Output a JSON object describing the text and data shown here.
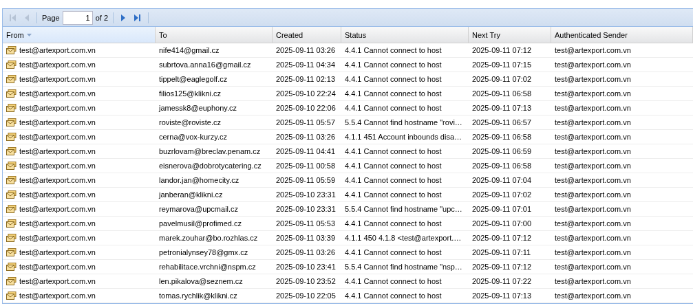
{
  "pager": {
    "buttons": [
      {
        "kind": "first",
        "disabled": true
      },
      {
        "kind": "prev",
        "disabled": true
      },
      {
        "kind": "next",
        "disabled": false
      },
      {
        "kind": "last",
        "disabled": false
      }
    ],
    "page_label": "Page",
    "page_value": "1",
    "page_total": "of 2"
  },
  "table": {
    "columns": [
      {
        "label": "From",
        "sorted": true
      },
      {
        "label": "To",
        "sorted": false
      },
      {
        "label": "Created",
        "sorted": false
      },
      {
        "label": "Status",
        "sorted": false
      },
      {
        "label": "Next Try",
        "sorted": false
      },
      {
        "label": "Authenticated Sender",
        "sorted": false
      }
    ],
    "rows": [
      [
        "test@artexport.com.vn",
        "nife414@gmail.cz",
        "2025-09-11 03:26",
        "4.4.1 Cannot connect to host",
        "2025-09-11 07:12",
        "test@artexport.com.vn"
      ],
      [
        "test@artexport.com.vn",
        "subrtova.anna16@gmail.cz",
        "2025-09-11 04:34",
        "4.4.1 Cannot connect to host",
        "2025-09-11 07:15",
        "test@artexport.com.vn"
      ],
      [
        "test@artexport.com.vn",
        "tippelt@eaglegolf.cz",
        "2025-09-11 02:13",
        "4.4.1 Cannot connect to host",
        "2025-09-11 07:02",
        "test@artexport.com.vn"
      ],
      [
        "test@artexport.com.vn",
        "filios125@klikni.cz",
        "2025-09-10 22:24",
        "4.4.1 Cannot connect to host",
        "2025-09-11 06:58",
        "test@artexport.com.vn"
      ],
      [
        "test@artexport.com.vn",
        "jamessk8@euphony.cz",
        "2025-09-10 22:06",
        "4.4.1 Cannot connect to host",
        "2025-09-11 07:13",
        "test@artexport.com.vn"
      ],
      [
        "test@artexport.com.vn",
        "roviste@roviste.cz",
        "2025-09-11 05:57",
        "5.5.4 Cannot find hostname \"rovi…",
        "2025-09-11 06:57",
        "test@artexport.com.vn"
      ],
      [
        "test@artexport.com.vn",
        "cerna@vox-kurzy.cz",
        "2025-09-11 03:26",
        "4.1.1 451 Account inbounds disa…",
        "2025-09-11 06:58",
        "test@artexport.com.vn"
      ],
      [
        "test@artexport.com.vn",
        "buzrlovam@breclav.penam.cz",
        "2025-09-11 04:41",
        "4.4.1 Cannot connect to host",
        "2025-09-11 06:59",
        "test@artexport.com.vn"
      ],
      [
        "test@artexport.com.vn",
        "eisnerova@dobrotycatering.cz",
        "2025-09-11 00:58",
        "4.4.1 Cannot connect to host",
        "2025-09-11 06:58",
        "test@artexport.com.vn"
      ],
      [
        "test@artexport.com.vn",
        "landor.jan@homecity.cz",
        "2025-09-11 05:59",
        "4.4.1 Cannot connect to host",
        "2025-09-11 07:04",
        "test@artexport.com.vn"
      ],
      [
        "test@artexport.com.vn",
        "janberan@klikni.cz",
        "2025-09-10 23:31",
        "4.4.1 Cannot connect to host",
        "2025-09-11 07:02",
        "test@artexport.com.vn"
      ],
      [
        "test@artexport.com.vn",
        "reymarova@upcmail.cz",
        "2025-09-10 23:31",
        "5.5.4 Cannot find hostname \"upc…",
        "2025-09-11 07:01",
        "test@artexport.com.vn"
      ],
      [
        "test@artexport.com.vn",
        "pavelmusil@profimed.cz",
        "2025-09-11 05:53",
        "4.4.1 Cannot connect to host",
        "2025-09-11 07:00",
        "test@artexport.com.vn"
      ],
      [
        "test@artexport.com.vn",
        "marek.zouhar@bo.rozhlas.cz",
        "2025-09-11 03:39",
        "4.1.1 450 4.1.8 <test@artexport.…",
        "2025-09-11 07:12",
        "test@artexport.com.vn"
      ],
      [
        "test@artexport.com.vn",
        "petronialynsey78@gmx.cz",
        "2025-09-11 03:26",
        "4.4.1 Cannot connect to host",
        "2025-09-11 07:11",
        "test@artexport.com.vn"
      ],
      [
        "test@artexport.com.vn",
        "rehabilitace.vrchni@nspm.cz",
        "2025-09-10 23:41",
        "5.5.4 Cannot find hostname \"nsp…",
        "2025-09-11 07:12",
        "test@artexport.com.vn"
      ],
      [
        "test@artexport.com.vn",
        "len.pikalova@seznem.cz",
        "2025-09-10 23:52",
        "4.4.1 Cannot connect to host",
        "2025-09-11 07:22",
        "test@artexport.com.vn"
      ],
      [
        "test@artexport.com.vn",
        "tomas.rychlik@klikni.cz",
        "2025-09-10 22:05",
        "4.4.1 Cannot connect to host",
        "2025-09-11 07:13",
        "test@artexport.com.vn"
      ]
    ]
  }
}
